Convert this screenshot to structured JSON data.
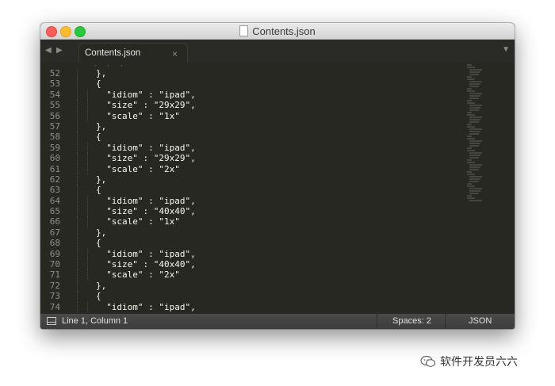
{
  "window": {
    "title": "Contents.json"
  },
  "tabbar": {
    "back_glyph": "◀",
    "forward_glyph": "▶",
    "tab_label": "Contents.json",
    "tab_close_glyph": "×",
    "menu_glyph": "▼"
  },
  "editor": {
    "fold_hint": "· · ·",
    "lines": [
      {
        "num": "52",
        "indent": 2,
        "text": "},"
      },
      {
        "num": "53",
        "indent": 2,
        "text": "{"
      },
      {
        "num": "54",
        "indent": 3,
        "text": "\"idiom\" : \"ipad\","
      },
      {
        "num": "55",
        "indent": 3,
        "text": "\"size\" : \"29x29\","
      },
      {
        "num": "56",
        "indent": 3,
        "text": "\"scale\" : \"1x\""
      },
      {
        "num": "57",
        "indent": 2,
        "text": "},"
      },
      {
        "num": "58",
        "indent": 2,
        "text": "{"
      },
      {
        "num": "59",
        "indent": 3,
        "text": "\"idiom\" : \"ipad\","
      },
      {
        "num": "60",
        "indent": 3,
        "text": "\"size\" : \"29x29\","
      },
      {
        "num": "61",
        "indent": 3,
        "text": "\"scale\" : \"2x\""
      },
      {
        "num": "62",
        "indent": 2,
        "text": "},"
      },
      {
        "num": "63",
        "indent": 2,
        "text": "{"
      },
      {
        "num": "64",
        "indent": 3,
        "text": "\"idiom\" : \"ipad\","
      },
      {
        "num": "65",
        "indent": 3,
        "text": "\"size\" : \"40x40\","
      },
      {
        "num": "66",
        "indent": 3,
        "text": "\"scale\" : \"1x\""
      },
      {
        "num": "67",
        "indent": 2,
        "text": "},"
      },
      {
        "num": "68",
        "indent": 2,
        "text": "{"
      },
      {
        "num": "69",
        "indent": 3,
        "text": "\"idiom\" : \"ipad\","
      },
      {
        "num": "70",
        "indent": 3,
        "text": "\"size\" : \"40x40\","
      },
      {
        "num": "71",
        "indent": 3,
        "text": "\"scale\" : \"2x\""
      },
      {
        "num": "72",
        "indent": 2,
        "text": "},"
      },
      {
        "num": "73",
        "indent": 2,
        "text": "{"
      },
      {
        "num": "74",
        "indent": 3,
        "text": "\"idiom\" : \"ipad\","
      }
    ]
  },
  "statusbar": {
    "position": "Line 1, Column 1",
    "spaces": "Spaces: 2",
    "syntax": "JSON"
  },
  "watermark": {
    "text": "软件开发员六六"
  },
  "colors": {
    "editor_bg": "#272822",
    "text": "#f8f8f2",
    "line_number": "#8f908a",
    "close": "#fc5f57",
    "minimize": "#fdbc2e",
    "zoom": "#28c840"
  }
}
